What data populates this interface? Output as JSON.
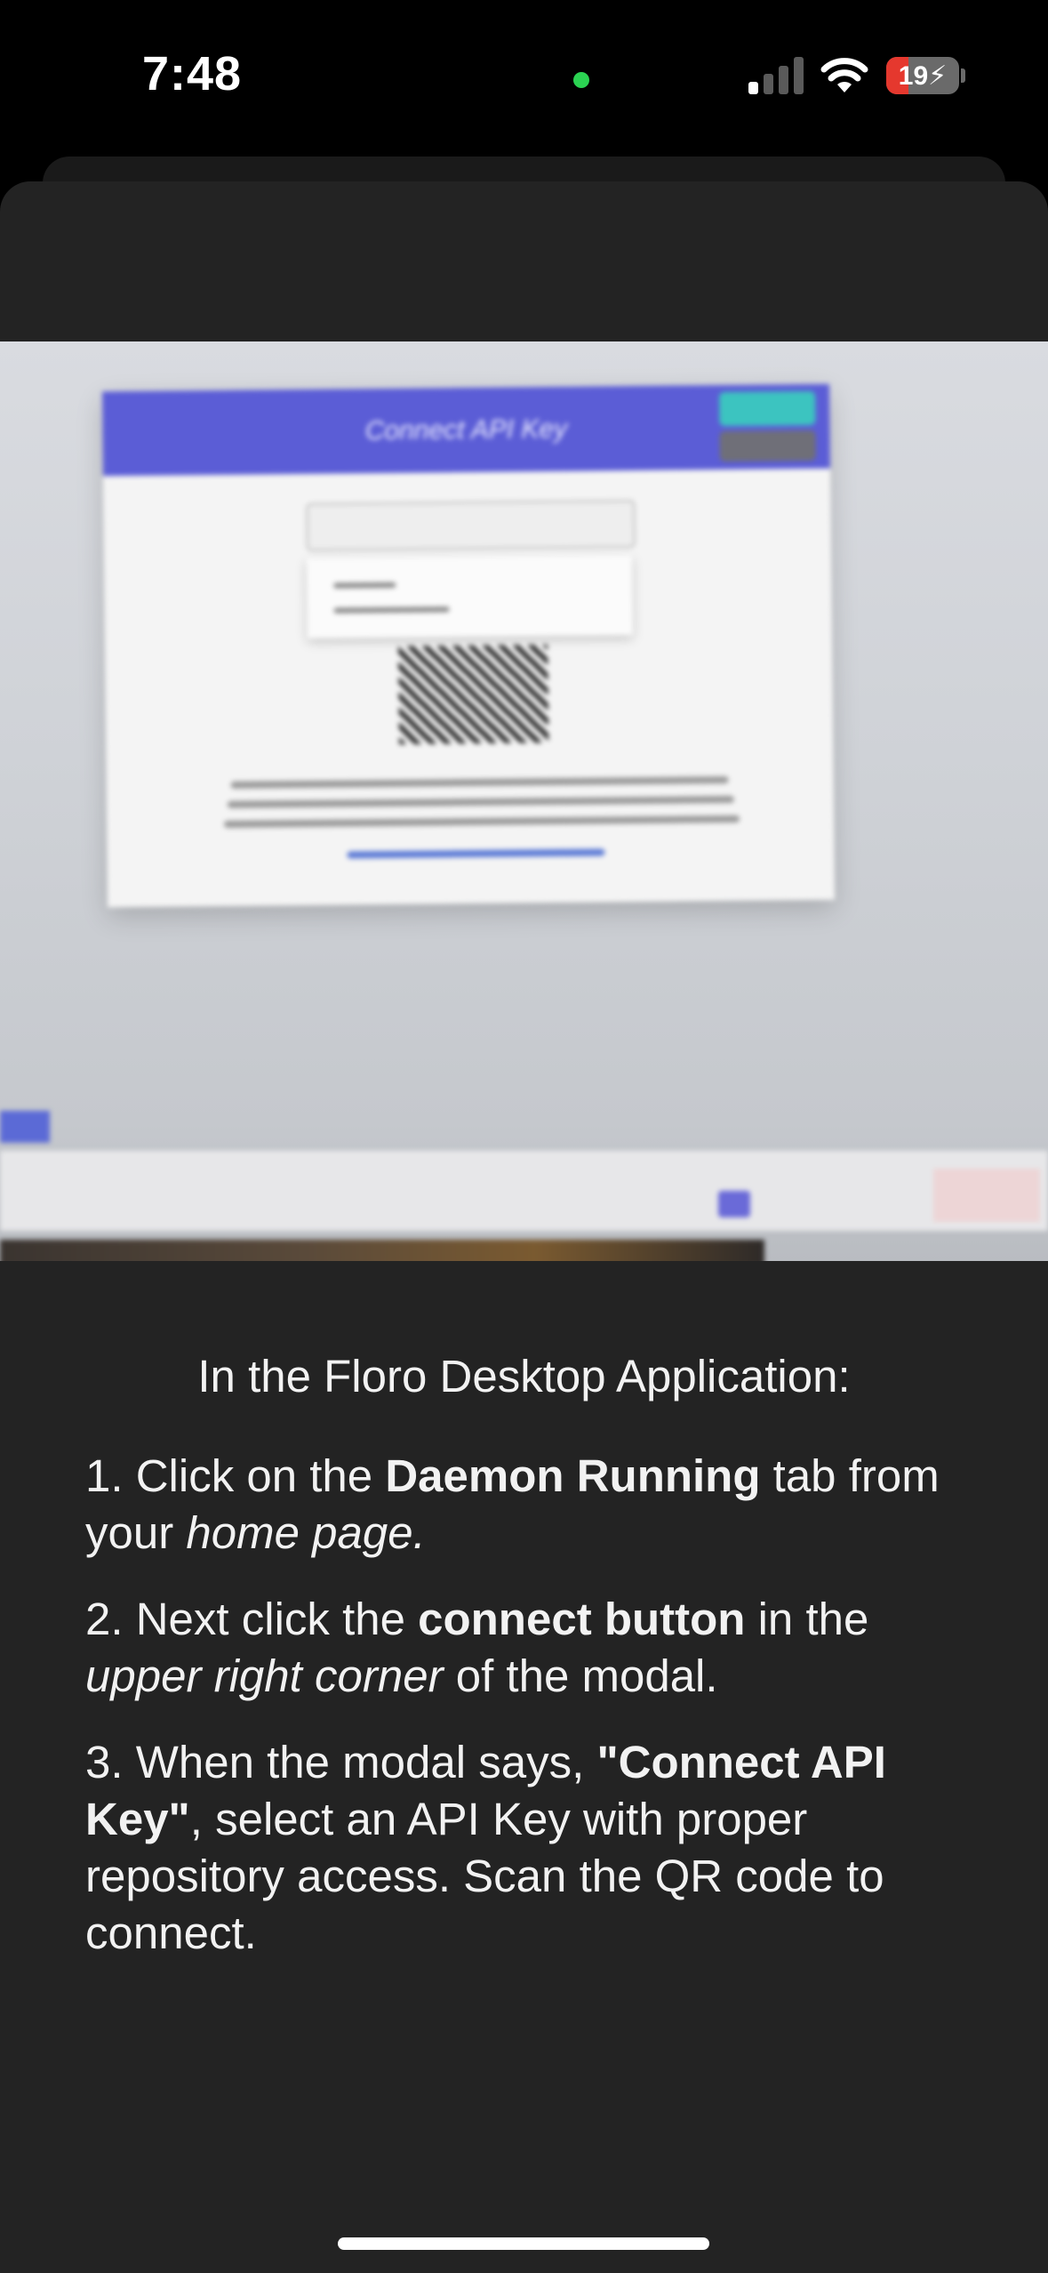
{
  "status_bar": {
    "time": "7:48",
    "battery_level": "19",
    "camera_indicator_color": "#2bd252",
    "battery_color": "#e5382e",
    "icons": [
      "signal-icon",
      "wifi-icon",
      "battery-charging-icon"
    ]
  },
  "camera_preview": {
    "modal_title": "Connect API Key"
  },
  "instructions": {
    "heading": "In the Floro Desktop Application:",
    "step1": {
      "prefix": "1. Click on the ",
      "bold": "Daemon Running",
      "middle": " tab from your ",
      "italic": "home page."
    },
    "step2": {
      "prefix": "2. Next click the ",
      "bold": "connect button",
      "middle": " in the ",
      "italic": "upper right corner",
      "suffix": " of the modal."
    },
    "step3": {
      "prefix": "3. When the modal says, ",
      "bold": "\"Connect API Key\"",
      "suffix": ", select an API Key with proper repository access. Scan the QR code to connect."
    }
  }
}
